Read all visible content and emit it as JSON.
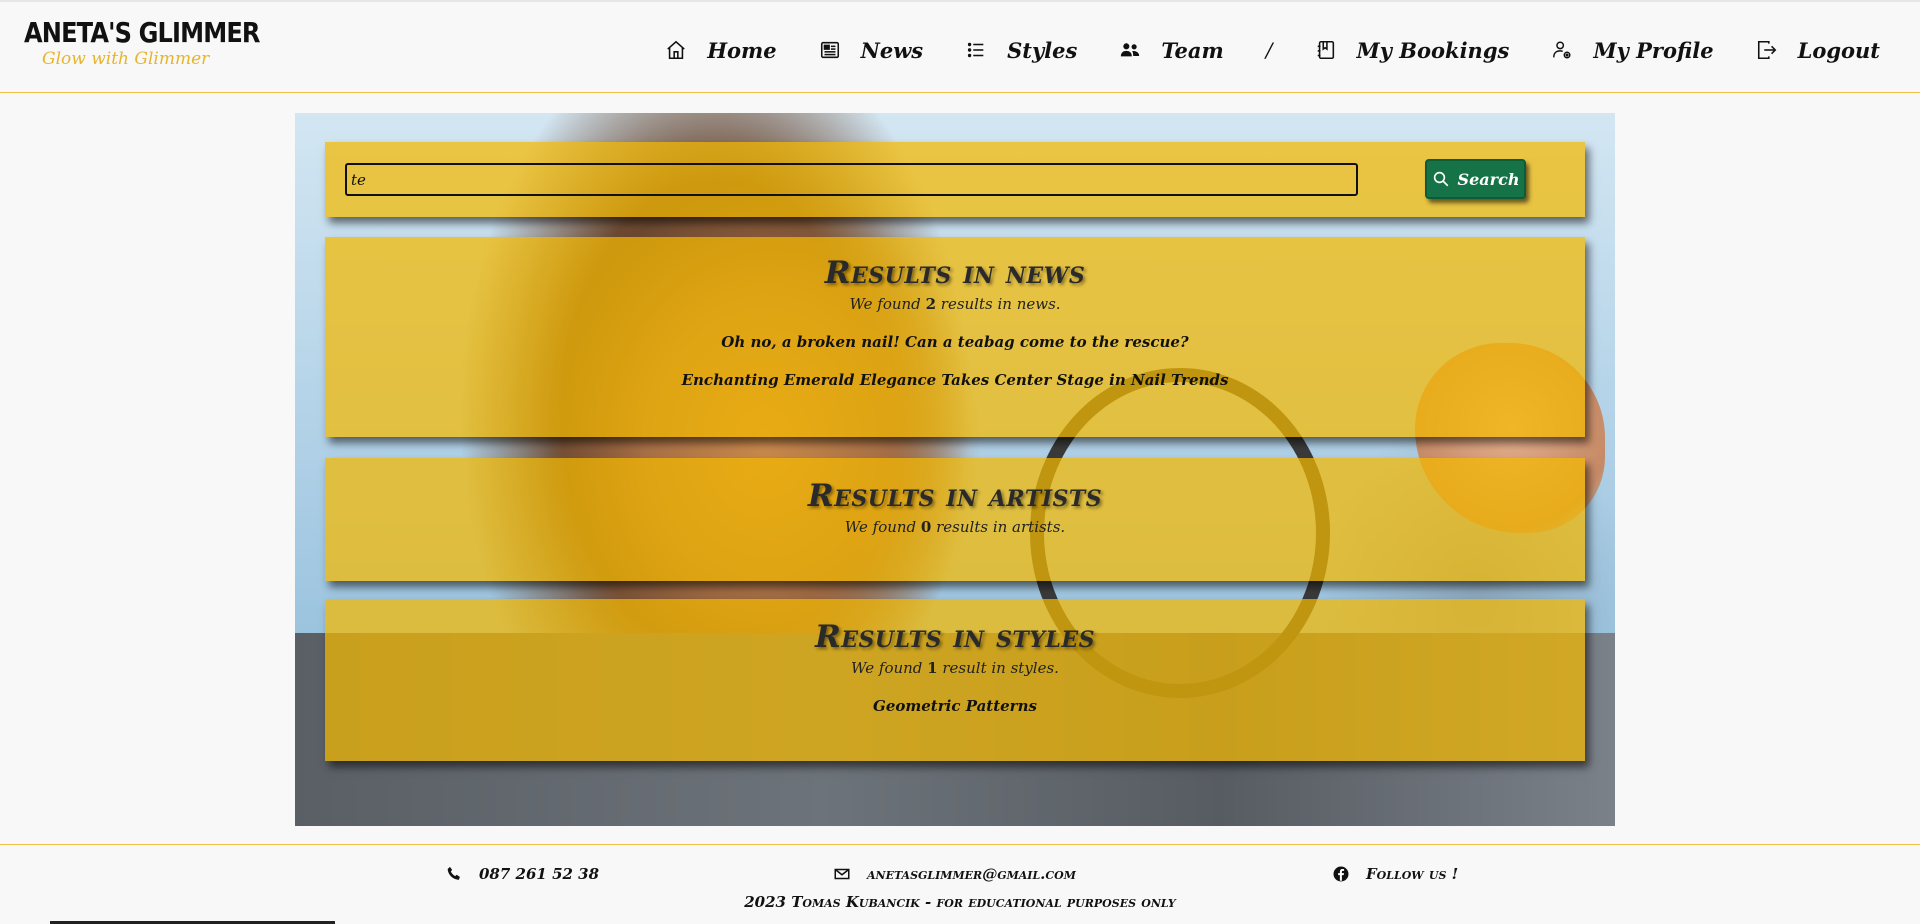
{
  "brand": {
    "name": "ANETA'S GLIMMER",
    "tagline": "Glow with Glimmer",
    "accent_color": "#f4b900",
    "button_color": "#157347"
  },
  "nav": {
    "items": [
      {
        "label": "Home",
        "icon": "home-icon"
      },
      {
        "label": "News",
        "icon": "newspaper-icon"
      },
      {
        "label": "Styles",
        "icon": "list-icon"
      },
      {
        "label": "Team",
        "icon": "people-icon"
      }
    ],
    "separator": "/",
    "account_items": [
      {
        "label": "My Bookings",
        "icon": "journal-icon"
      },
      {
        "label": "My Profile",
        "icon": "person-gear-icon"
      },
      {
        "label": "Logout",
        "icon": "logout-icon"
      }
    ]
  },
  "search": {
    "value": "te",
    "button_label": "Search"
  },
  "results": {
    "news": {
      "title": "Results in news",
      "found_prefix": "We found ",
      "count": "2",
      "found_suffix": " results in news.",
      "items": [
        "Oh no, a broken nail! Can a teabag come to the rescue?",
        "Enchanting Emerald Elegance Takes Center Stage in Nail Trends"
      ]
    },
    "artists": {
      "title": "Results in artists",
      "found_prefix": "We found ",
      "count": "0",
      "found_suffix": " results in artists.",
      "items": []
    },
    "styles": {
      "title": "Results in styles",
      "found_prefix": "We found ",
      "count": "1",
      "found_suffix": " result in styles.",
      "items": [
        "Geometric Patterns"
      ]
    }
  },
  "footer": {
    "phone": "087 261 52 38",
    "email": "anetasglimmer@gmail.com",
    "follow": "Follow us !",
    "copyright": "2023 Tomas Kubancik - for educational purposes only"
  }
}
